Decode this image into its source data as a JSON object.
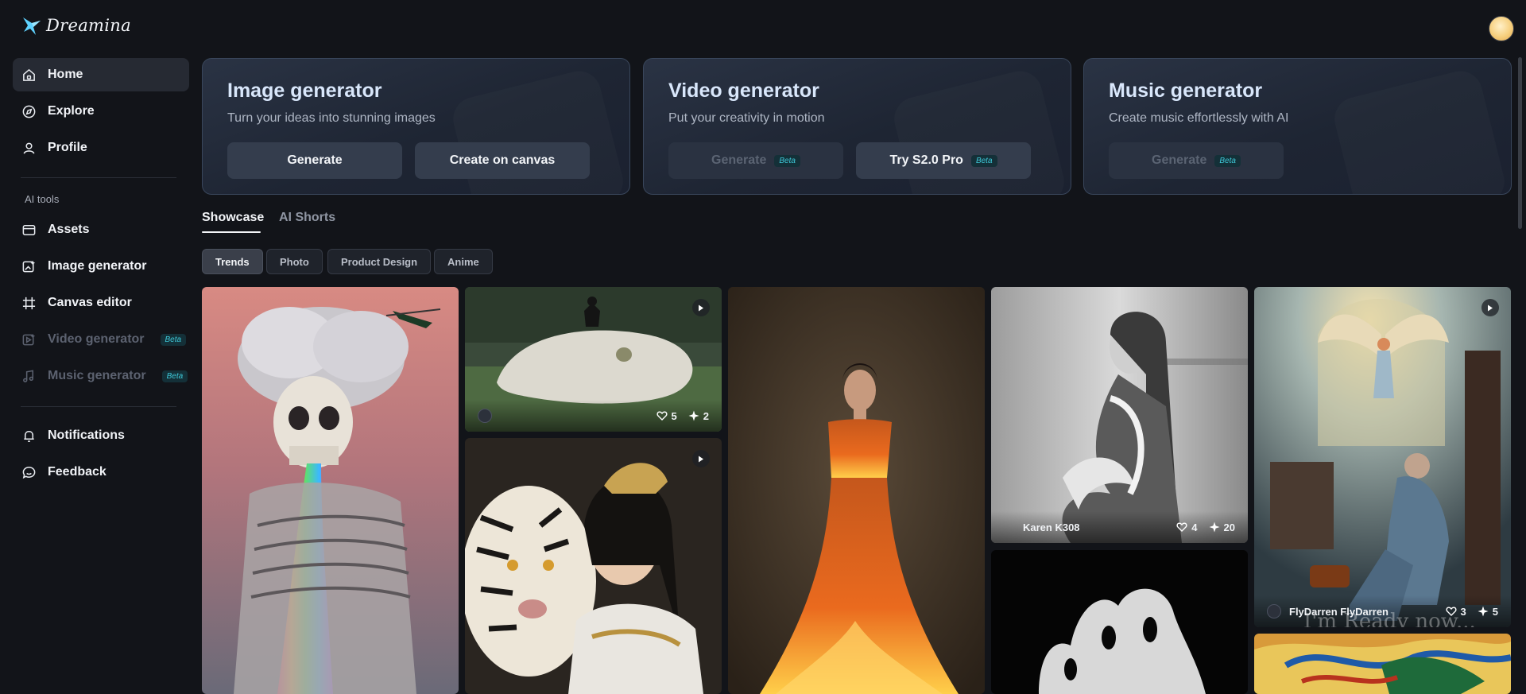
{
  "app": {
    "name": "Dreamina"
  },
  "sidebar": {
    "items": [
      {
        "label": "Home",
        "icon": "home-icon",
        "active": true
      },
      {
        "label": "Explore",
        "icon": "compass-icon"
      },
      {
        "label": "Profile",
        "icon": "user-icon"
      }
    ],
    "section_label": "AI tools",
    "tools": [
      {
        "label": "Assets",
        "icon": "folder-icon"
      },
      {
        "label": "Image generator",
        "icon": "image-gen-icon"
      },
      {
        "label": "Canvas editor",
        "icon": "canvas-icon"
      },
      {
        "label": "Video generator",
        "icon": "video-icon",
        "disabled": true,
        "badge": "Beta"
      },
      {
        "label": "Music generator",
        "icon": "music-icon",
        "disabled": true,
        "badge": "Beta"
      }
    ],
    "bottom": [
      {
        "label": "Notifications",
        "icon": "bell-icon"
      },
      {
        "label": "Feedback",
        "icon": "feedback-icon"
      }
    ]
  },
  "generators": [
    {
      "title": "Image generator",
      "subtitle": "Turn your ideas into stunning images",
      "buttons": [
        {
          "label": "Generate"
        },
        {
          "label": "Create on canvas"
        }
      ]
    },
    {
      "title": "Video generator",
      "subtitle": "Put your creativity in motion",
      "buttons": [
        {
          "label": "Generate",
          "badge": "Beta",
          "disabled": true
        },
        {
          "label": "Try S2.0 Pro",
          "badge": "Beta"
        }
      ]
    },
    {
      "title": "Music generator",
      "subtitle": "Create music effortlessly with AI",
      "buttons": [
        {
          "label": "Generate",
          "badge": "Beta",
          "disabled": true
        }
      ]
    }
  ],
  "tabs": [
    {
      "label": "Showcase",
      "active": true
    },
    {
      "label": "AI Shorts"
    }
  ],
  "filters": [
    {
      "label": "Trends",
      "active": true
    },
    {
      "label": "Photo"
    },
    {
      "label": "Product Design"
    },
    {
      "label": "Anime"
    }
  ],
  "gallery": [
    {
      "id": "skull-cloud"
    },
    {
      "id": "white-snake",
      "author": "",
      "likes": "5",
      "remixes": "2"
    },
    {
      "id": "tiger-warrior"
    },
    {
      "id": "fire-dress"
    },
    {
      "id": "marble-woman",
      "author": "Karen K308",
      "likes": "4",
      "remixes": "20"
    },
    {
      "id": "ghost"
    },
    {
      "id": "angel-prayer",
      "author": "FlyDarren FlyDarren",
      "likes": "3",
      "remixes": "5",
      "caption": "I'm Ready now..."
    },
    {
      "id": "colorful-bird"
    }
  ],
  "colors": {
    "accent": "#3ec8d8",
    "background": "#121419",
    "card_border": "#39465b"
  }
}
